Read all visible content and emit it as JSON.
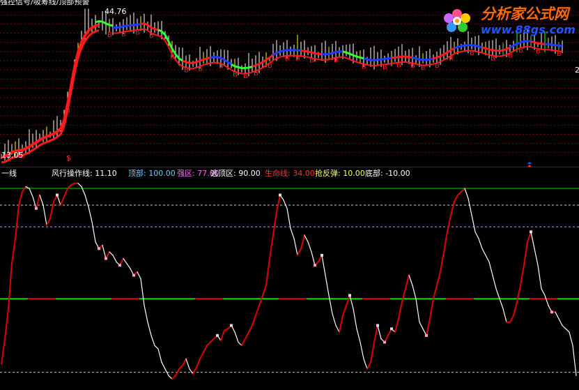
{
  "header_top": "强控信号/吸筹线/顶部预警",
  "watermark": {
    "title": "分析家公式网",
    "url": "www.88gs.com"
  },
  "colors": {
    "background": "#000000",
    "price_red": "#ff1a1a",
    "price_blue": "#1a3cff",
    "price_green": "#33ff33",
    "candle_white": "#ffffff",
    "candle_yellow": "#ffff00",
    "grid_red": "#7a0000",
    "osc_white": "#ffffff",
    "osc_red": "#e00000",
    "life_line_green": "#00dd00",
    "logo_orange": "#ff6a00",
    "logo_blue": "#2255ff"
  },
  "indicator_legend": [
    {
      "label": "一线",
      "value": "",
      "color": "#ffffff"
    },
    {
      "label": "风行操作线:",
      "value": "11.10",
      "color": "#ffffff"
    },
    {
      "label": "顶部:",
      "value": "100.00",
      "color": "#66ccff"
    },
    {
      "label": "强区:",
      "value": "77.00",
      "color": "#ff66ff"
    },
    {
      "label": "逃顶区:",
      "value": "90.00",
      "color": "#ffffff"
    },
    {
      "label": "生命线:",
      "value": "34.00",
      "color": "#ff3333"
    },
    {
      "label": "抢反弹:",
      "value": "10.00",
      "color": "#ffff66"
    },
    {
      "label": "底部:",
      "value": "-10.00",
      "color": "#ffffff"
    }
  ],
  "chart_data": [
    {
      "type": "line",
      "panel": "price",
      "annotations": {
        "high_label": "44.76",
        "low_label": "13.05",
        "right_label": "2",
        "signal_marker": "$",
        "buy_marker": "B"
      },
      "x": [
        0,
        5,
        10,
        15,
        20,
        25,
        30,
        35,
        40,
        45,
        50,
        55,
        60,
        65,
        70,
        75,
        80,
        85,
        90,
        95,
        100,
        105,
        110,
        115,
        120,
        125,
        130,
        135,
        140,
        145,
        150,
        155,
        160,
        165,
        170,
        175,
        180,
        185,
        190,
        195,
        200,
        205,
        210,
        215,
        220,
        225,
        230,
        235,
        240,
        245,
        250,
        255,
        260,
        265,
        270,
        275,
        280,
        285,
        290,
        295,
        300,
        305,
        310,
        315,
        320,
        325,
        330,
        335,
        340,
        345,
        350,
        355,
        360,
        365,
        370,
        375,
        380,
        385,
        390,
        395,
        400,
        405,
        410,
        415,
        420,
        425,
        430,
        435,
        440,
        445,
        450,
        455,
        460,
        465,
        470,
        475,
        480,
        485,
        490,
        495,
        500,
        505,
        510,
        515,
        520,
        525,
        530,
        535,
        540,
        545,
        550,
        555,
        560,
        565,
        570,
        575,
        580,
        585,
        590,
        595,
        600,
        605,
        610,
        615,
        620,
        625,
        630,
        635,
        640,
        645,
        650,
        655,
        660,
        665,
        670,
        675,
        680,
        685,
        690,
        695,
        700,
        705,
        710,
        715,
        720,
        725,
        730,
        735,
        740,
        745,
        750,
        755,
        760,
        765,
        770,
        775,
        780,
        785,
        790,
        795,
        800,
        805,
        810,
        815,
        820,
        825
      ],
      "series": [
        {
          "values": [
            13.05,
            13.2,
            13.6,
            14.1,
            14.3,
            14.5,
            14.6,
            14.9,
            15.3,
            15.8,
            16.2,
            16.8,
            17.2,
            17.5,
            17.8,
            18.1,
            18.6,
            19.2,
            21.0,
            24.5,
            28.5,
            32.5,
            35.8,
            38.0,
            39.5,
            40.5,
            41.2,
            41.6,
            41.8,
            41.7,
            41.3,
            41.0,
            40.8,
            40.8,
            40.9,
            41.1,
            41.2,
            41.3,
            41.4,
            41.5,
            41.6,
            41.7,
            41.4,
            40.8,
            40.5,
            40.3,
            40.0,
            39.2,
            37.8,
            36.2,
            35.0,
            34.1,
            33.6,
            33.3,
            33.1,
            33.1,
            33.3,
            33.6,
            33.9,
            34.1,
            34.3,
            34.4,
            34.4,
            34.2,
            33.8,
            33.3,
            32.8,
            32.4,
            32.2,
            32.0,
            32.0,
            32.1,
            32.3,
            32.6,
            32.9,
            33.3,
            33.8,
            34.3,
            34.9,
            35.3,
            35.6,
            35.8,
            35.9,
            35.9,
            35.9,
            35.9,
            35.8,
            35.7,
            35.6,
            35.4,
            35.2,
            35.1,
            35.0,
            35.0,
            35.1,
            35.3,
            35.5,
            35.6,
            35.6,
            35.4,
            35.1,
            34.8,
            34.5,
            34.3,
            34.1,
            33.9,
            33.8,
            33.7,
            33.8,
            33.9,
            34.0,
            34.1,
            34.2,
            34.3,
            34.4,
            34.5,
            34.5,
            34.4,
            34.3,
            34.1,
            33.9,
            33.8,
            33.8,
            33.9,
            34.1,
            34.3,
            34.6,
            35.0,
            35.4,
            35.9,
            36.3,
            36.6,
            36.8,
            36.9,
            37.0,
            37.0,
            36.9,
            36.7,
            36.5,
            36.3,
            36.1,
            35.9,
            35.8,
            35.8,
            35.9,
            36.1,
            36.5,
            36.9,
            37.3,
            37.6,
            37.8,
            37.9,
            37.8,
            37.6,
            37.4,
            37.3,
            37.2,
            37.2,
            37.1,
            37.0,
            36.9,
            36.8
          ]
        }
      ],
      "ylim": [
        12,
        46
      ]
    },
    {
      "type": "line",
      "panel": "oscillator",
      "x": [
        0,
        5,
        10,
        15,
        20,
        25,
        30,
        35,
        40,
        45,
        50,
        55,
        60,
        65,
        70,
        75,
        80,
        85,
        90,
        95,
        100,
        105,
        110,
        115,
        120,
        125,
        130,
        135,
        140,
        145,
        150,
        155,
        160,
        165,
        170,
        175,
        180,
        185,
        190,
        195,
        200,
        205,
        210,
        215,
        220,
        225,
        230,
        235,
        240,
        245,
        250,
        255,
        260,
        265,
        270,
        275,
        280,
        285,
        290,
        295,
        300,
        305,
        310,
        315,
        320,
        325,
        330,
        335,
        340,
        345,
        350,
        355,
        360,
        365,
        370,
        375,
        380,
        385,
        390,
        395,
        400,
        405,
        410,
        415,
        420,
        425,
        430,
        435,
        440,
        445,
        450,
        455,
        460,
        465,
        470,
        475,
        480,
        485,
        490,
        495,
        500,
        505,
        510,
        515,
        520,
        525,
        530,
        535,
        540,
        545,
        550,
        555,
        560,
        565,
        570,
        575,
        580,
        585,
        590,
        595,
        600,
        605,
        610,
        615,
        620,
        625,
        630,
        635,
        640,
        645,
        650,
        655,
        660,
        665,
        670,
        675,
        680,
        685,
        690,
        695,
        700,
        705,
        710,
        715,
        720,
        725,
        730,
        735,
        740,
        745,
        750,
        755,
        760,
        765,
        770,
        775,
        780,
        785,
        790,
        795,
        800,
        805,
        810,
        815,
        820,
        825
      ],
      "series": [
        {
          "name": "风行操作线",
          "values": [
            -5,
            10,
            28,
            55,
            70,
            90,
            98,
            101,
            100,
            95,
            88,
            96,
            90,
            78,
            82,
            92,
            96,
            90,
            95,
            100,
            102,
            103,
            103,
            101,
            96,
            89,
            80,
            68,
            64,
            66,
            58,
            62,
            60,
            56,
            54,
            58,
            55,
            52,
            48,
            50,
            46,
            30,
            20,
            12,
            6,
            4,
            -4,
            -8,
            -12,
            -14,
            -12,
            -8,
            -6,
            -2,
            -8,
            -11,
            -7,
            -2,
            2,
            6,
            8,
            10,
            12,
            9,
            15,
            16,
            18,
            14,
            8,
            6,
            10,
            14,
            18,
            24,
            30,
            36,
            42,
            58,
            72,
            86,
            96,
            93,
            88,
            76,
            70,
            60,
            64,
            72,
            68,
            62,
            54,
            56,
            60,
            48,
            36,
            25,
            18,
            14,
            24,
            30,
            36,
            28,
            16,
            8,
            -2,
            -8,
            -4,
            8,
            18,
            10,
            8,
            12,
            16,
            14,
            22,
            32,
            40,
            48,
            42,
            34,
            20,
            16,
            12,
            22,
            34,
            42,
            50,
            62,
            74,
            84,
            92,
            96,
            98,
            100,
            94,
            84,
            74,
            70,
            64,
            60,
            56,
            48,
            40,
            34,
            28,
            20,
            20,
            24,
            32,
            42,
            54,
            68,
            74,
            64,
            54,
            40,
            36,
            30,
            26,
            26,
            22,
            18,
            16,
            14,
            6,
            -12
          ]
        }
      ],
      "reference_lines": [
        {
          "name": "顶部",
          "value": 100.0,
          "style": "solid"
        },
        {
          "name": "逃顶区",
          "value": 90.0,
          "style": "dashed"
        },
        {
          "name": "强区",
          "value": 77.0,
          "style": "dashed"
        },
        {
          "name": "生命线",
          "value": 34.0,
          "style": "solid"
        },
        {
          "name": "底部",
          "value": -10.0,
          "style": "dashed"
        }
      ],
      "ylim": [
        -16,
        105
      ]
    }
  ]
}
